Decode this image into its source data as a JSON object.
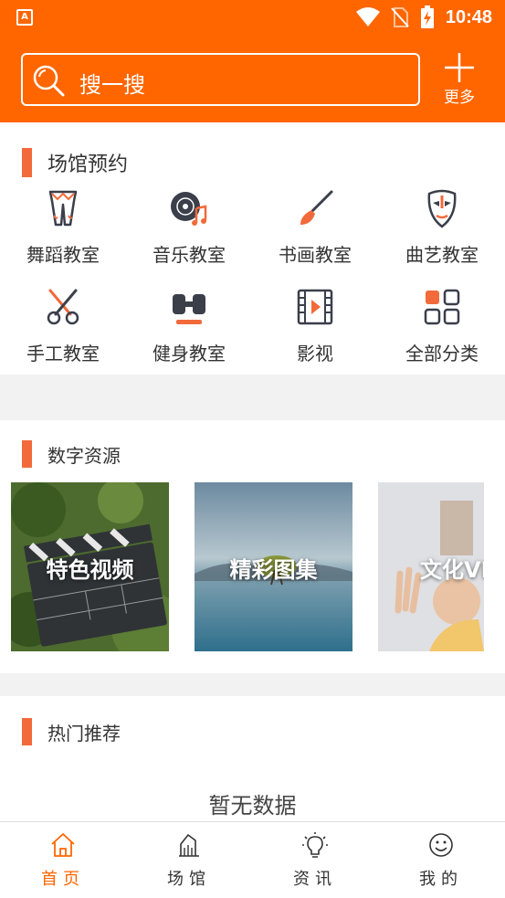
{
  "status_bar": {
    "time": "10:48"
  },
  "search": {
    "placeholder": "搜一搜"
  },
  "more": {
    "label": "更多"
  },
  "venue": {
    "title": "场馆预约",
    "items": [
      {
        "label": "舞蹈教室",
        "icon": "dance-pants-icon"
      },
      {
        "label": "音乐教室",
        "icon": "music-disc-icon"
      },
      {
        "label": "书画教室",
        "icon": "paint-brush-icon"
      },
      {
        "label": "曲艺教室",
        "icon": "opera-mask-icon"
      },
      {
        "label": "手工教室",
        "icon": "scissors-icon"
      },
      {
        "label": "健身教室",
        "icon": "dumbbell-icon"
      },
      {
        "label": "影视",
        "icon": "film-icon"
      },
      {
        "label": "全部分类",
        "icon": "all-categories-icon"
      }
    ]
  },
  "digital": {
    "title": "数字资源",
    "tiles": [
      {
        "label": "特色视频"
      },
      {
        "label": "精彩图集"
      },
      {
        "label": "文化VR"
      }
    ]
  },
  "hot": {
    "title": "热门推荐",
    "empty_text": "暂无数据"
  },
  "tabbar": {
    "tabs": [
      {
        "label": "首页",
        "active": true
      },
      {
        "label": "场馆",
        "active": false
      },
      {
        "label": "资讯",
        "active": false
      },
      {
        "label": "我的",
        "active": false
      }
    ]
  },
  "colors": {
    "brand": "#ff6600",
    "accent_bar": "#f26a3b",
    "icon_dark": "#3a3f4a"
  }
}
